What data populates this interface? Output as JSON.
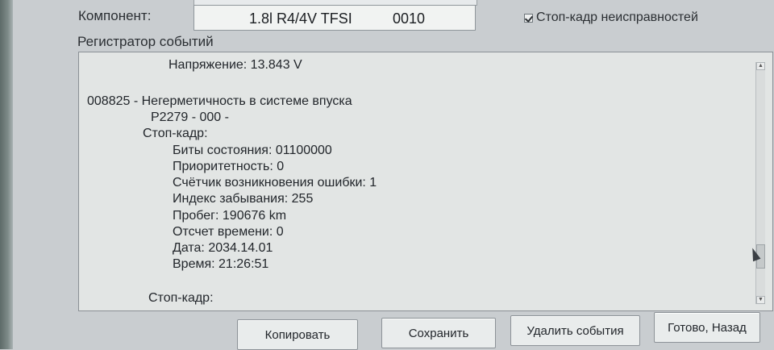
{
  "header": {
    "component_label": "Компонент:",
    "component_name": "1.8l R4/4V TFSI",
    "component_code": "0010",
    "freeze_frame_label": "Стоп-кадр неисправностей",
    "freeze_frame_checked": true
  },
  "log": {
    "group_label": "Регистратор событий",
    "lines": [
      "Напряжение: 13.843 V",
      "008825 - Негерметичность в системе впуска",
      "P2279 - 000 -",
      "Стоп-кадр:",
      "Биты состояния: 01100000",
      "Приоритетность: 0",
      "Счётчик возникновения ошибки: 1",
      "Индекс забывания: 255",
      "Пробег: 190676 km",
      "Отсчет времени: 0",
      "Дата: 2034.14.01",
      "Время: 21:26:51",
      "Стоп-кадр:"
    ]
  },
  "buttons": {
    "copy": "Копировать",
    "save": "Сохранить",
    "delete": "Удалить события",
    "done": "Готово, Назад"
  }
}
